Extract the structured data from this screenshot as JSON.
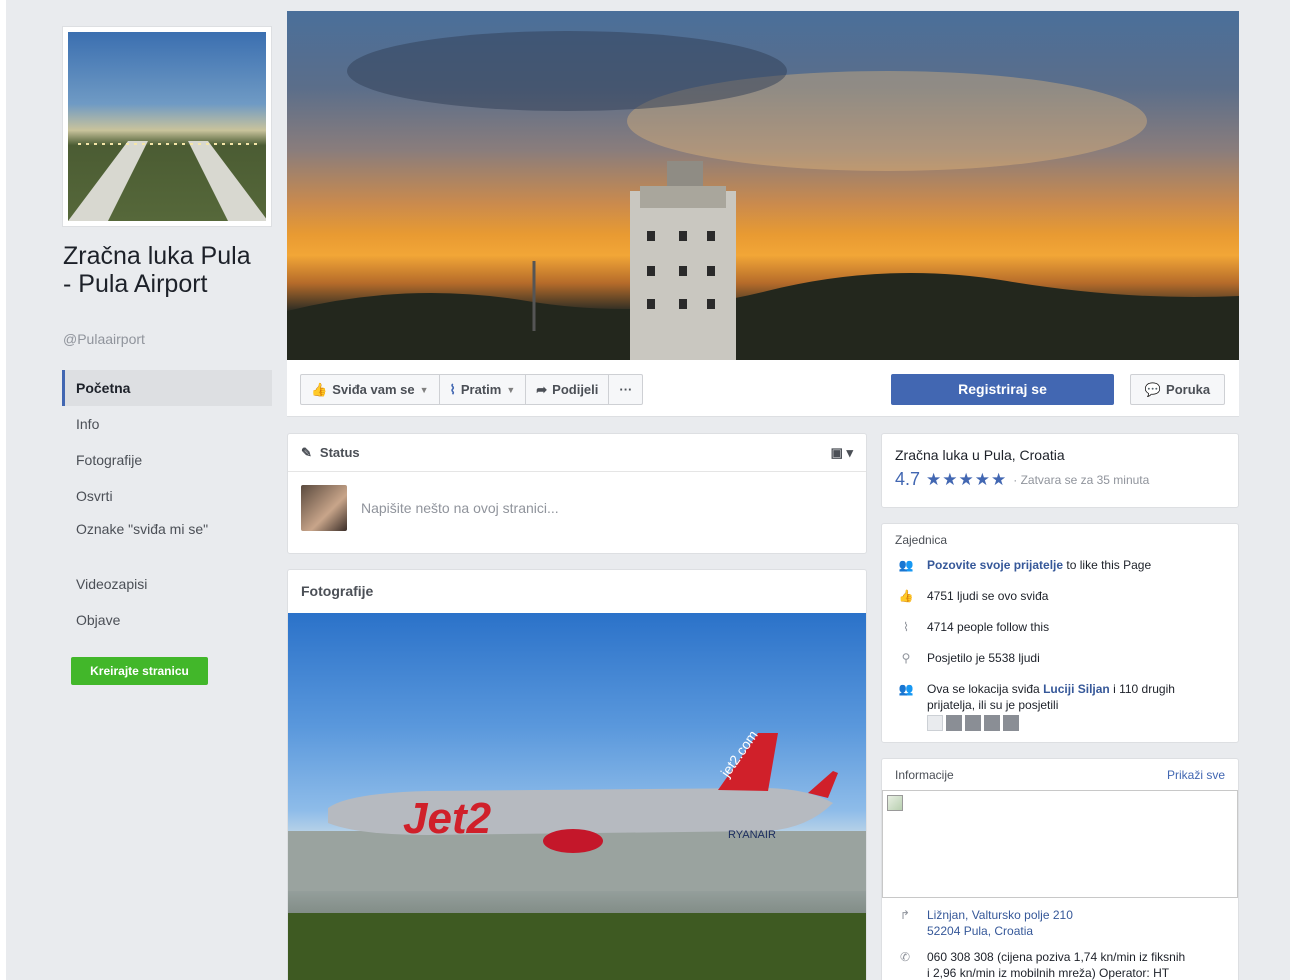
{
  "page": {
    "name": "Zračna luka Pula - Pula Airport",
    "handle": "@Pulaairport"
  },
  "nav": {
    "items": [
      "Početna",
      "Info",
      "Fotografije",
      "Osvrti",
      "Oznake \"sviđa mi se\"",
      "Videozapisi",
      "Objave"
    ],
    "active": "Početna",
    "create_page": "Kreirajte stranicu"
  },
  "actions": {
    "like": "Sviđa vam se",
    "follow": "Pratim",
    "share": "Podijeli",
    "more": "···",
    "register": "Registriraj se",
    "message": "Poruka"
  },
  "status": {
    "title": "Status",
    "placeholder": "Napišite nešto na ovoj stranici..."
  },
  "photos": {
    "title": "Fotografije",
    "jet_text": "Jet2",
    "jet_tail": "jet2.com",
    "ryanair_text": "RYANAIR"
  },
  "place": {
    "name": "Zračna luka u Pula, Croatia",
    "rating": "4.7",
    "stars": "★★★★★",
    "closes": "· Zatvara se za 35 minuta"
  },
  "community": {
    "title": "Zajednica",
    "invite_link": "Pozovite svoje prijatelje",
    "invite_rest": " to like this Page",
    "likes": "4751 ljudi se ovo sviđa",
    "follows": "4714 people follow this",
    "visited": "Posjetilo je 5538 ljudi",
    "friends_pre": "Ova se lokacija sviđa ",
    "friends_link": "Luciji Siljan",
    "friends_rest": " i 110 drugih prijatelja, ili su je posjetili"
  },
  "info": {
    "title": "Informacije",
    "show_all": "Prikaži sve",
    "address_line1": "Ližnjan, Valtursko polje 210",
    "address_line2": "52204 Pula, Croatia",
    "phone_line1": "060 308 308 (cijena poziva 1,74 kn/min iz fiksnih",
    "phone_line2": "i 2,96 kn/min iz mobilnih mreža) Operator: HT"
  },
  "colors": {
    "brand_blue": "#4267b2",
    "create_green": "#42b72a",
    "background": "#e9ebee"
  }
}
